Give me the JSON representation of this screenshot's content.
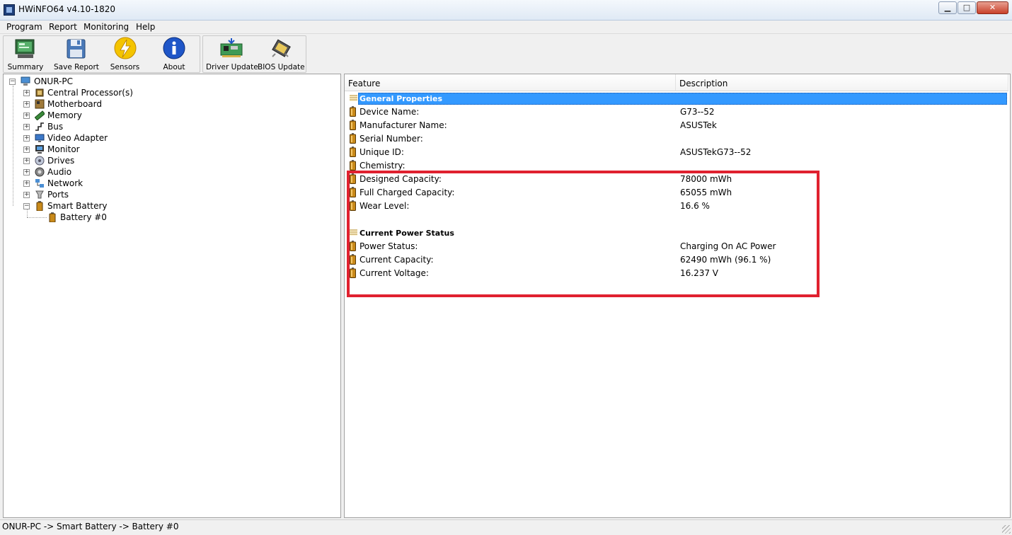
{
  "window": {
    "title": "HWiNFO64 v4.10-1820"
  },
  "menu": [
    "Program",
    "Report",
    "Monitoring",
    "Help"
  ],
  "toolbar": {
    "summary": "Summary",
    "save_report": "Save Report",
    "sensors": "Sensors",
    "about": "About",
    "driver_update": "Driver Update",
    "bios_update": "BIOS Update"
  },
  "tree": {
    "root": "ONUR-PC",
    "items": [
      "Central Processor(s)",
      "Motherboard",
      "Memory",
      "Bus",
      "Video Adapter",
      "Monitor",
      "Drives",
      "Audio",
      "Network",
      "Ports",
      "Smart Battery"
    ],
    "child": "Battery #0"
  },
  "columns": {
    "feature": "Feature",
    "description": "Description"
  },
  "sections": {
    "general": "General Properties",
    "power": "Current Power Status"
  },
  "general_properties": [
    {
      "feature": "Device Name:",
      "value": "G73--52"
    },
    {
      "feature": "Manufacturer Name:",
      "value": "ASUSTek"
    },
    {
      "feature": "Serial Number:",
      "value": ""
    },
    {
      "feature": "Unique ID:",
      "value": " ASUSTekG73--52"
    },
    {
      "feature": "Chemistry:",
      "value": ""
    },
    {
      "feature": "Designed Capacity:",
      "value": "78000 mWh"
    },
    {
      "feature": "Full Charged Capacity:",
      "value": "65055 mWh"
    },
    {
      "feature": "Wear Level:",
      "value": "16.6 %"
    }
  ],
  "power_status": [
    {
      "feature": "Power Status:",
      "value": "Charging On AC Power"
    },
    {
      "feature": "Current Capacity:",
      "value": "62490 mWh (96.1 %)"
    },
    {
      "feature": "Current Voltage:",
      "value": "16.237 V"
    }
  ],
  "status_bar": {
    "path": "ONUR-PC -> Smart Battery -> Battery #0"
  },
  "colors": {
    "selection": "#3399ff",
    "highlight": "#e0212f",
    "battery": "#c98a1a"
  }
}
